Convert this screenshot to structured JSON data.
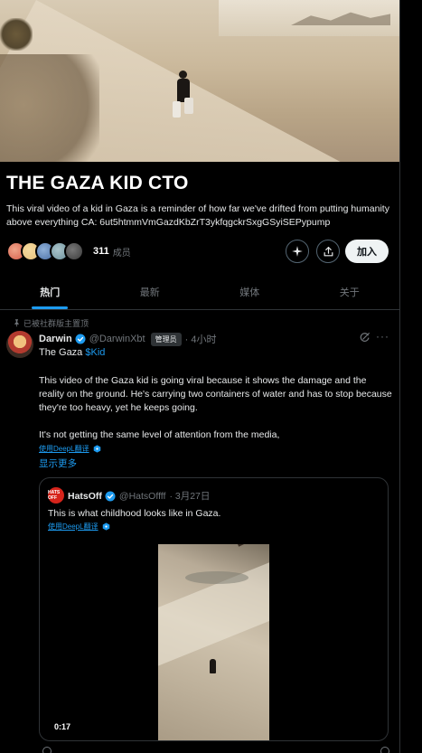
{
  "community": {
    "title": "THE GAZA KID CTO",
    "description": "This viral video of a kid in Gaza is a reminder of how far we've drifted from putting humanity above everything CA: 6ut5htmmVmGazdKbZrT3ykfqgckrSxgGSyiSEPypump",
    "member_count": "311",
    "member_label": "成员",
    "join_label": "加入",
    "avatar_colors": [
      "#d65d4a",
      "#e8c07a",
      "#4a6fa5",
      "#6c8f9a",
      "#3b3b3b"
    ]
  },
  "tabs": [
    {
      "label": "热门",
      "active": true
    },
    {
      "label": "最新",
      "active": false
    },
    {
      "label": "媒体",
      "active": false
    },
    {
      "label": "关于",
      "active": false
    }
  ],
  "post": {
    "pinned_label": "已被社群版主置顶",
    "author_name": "Darwin",
    "author_handle": "@DarwinXbt",
    "role_badge": "管理员",
    "time": "· 4小时",
    "line1_prefix": "The Gaza ",
    "cashtag": "$Kid",
    "body_p1": "This video of the Gaza kid is going viral because it shows the damage and the reality on the ground. He's carrying two containers of water and has to stop because they're too heavy, yet he keeps going.",
    "body_p2": "It's not getting the same level of attention from the media,",
    "translate_label": "使用DeepL翻译",
    "show_more": "显示更多"
  },
  "quote": {
    "avatar_text": "HATS OFF",
    "author_name": "HatsOff",
    "author_handle": "@HatsOffff",
    "time": "· 3月27日",
    "text": "This is what childhood looks like in Gaza.",
    "translate_label": "使用DeepL翻译",
    "video_duration": "0:17"
  },
  "colors": {
    "accent": "#1d9bf0",
    "background": "#000000",
    "muted": "#71767b"
  }
}
